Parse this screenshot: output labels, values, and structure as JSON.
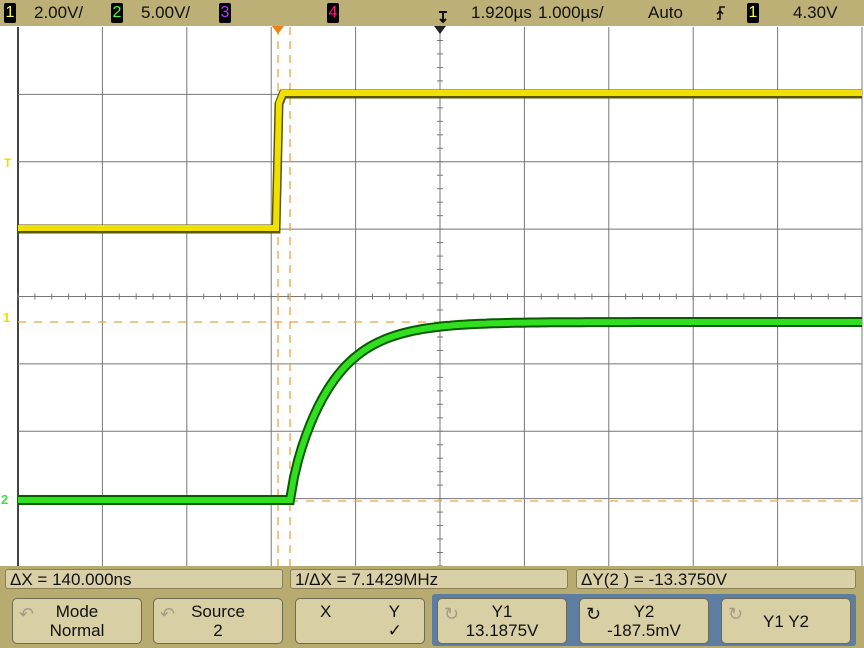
{
  "status_bar": {
    "channels": [
      {
        "number": "1",
        "scale": "2.00V/",
        "color": "#ffff40"
      },
      {
        "number": "2",
        "scale": "5.00V/",
        "color": "#40ff40"
      },
      {
        "number": "3",
        "scale": "",
        "color": "#b040ff"
      },
      {
        "number": "4",
        "scale": "",
        "color": "#ff2080"
      }
    ],
    "time_delay": "1.920µs",
    "time_scale": "1.000µs/",
    "trigger_mode": "Auto",
    "trigger_slope_icon": "rising-edge-icon",
    "trigger_source": "1",
    "trigger_level": "4.30V"
  },
  "plot": {
    "left_markers": [
      {
        "label": "T",
        "name": "trigger-level-marker",
        "color": "#e8e000"
      },
      {
        "label": "1",
        "name": "channel-1-ground-marker",
        "color": "#e8e000"
      },
      {
        "label": "2",
        "name": "channel-2-ground-marker",
        "color": "#40e040"
      }
    ],
    "divisions": {
      "horizontal": 10,
      "vertical": 8
    },
    "colors": {
      "ch1": "#f0e000",
      "ch2": "#30e020",
      "cursor": "#f0a040",
      "grid": "#777777",
      "trigger_marker": "#f08010"
    }
  },
  "measurements": {
    "delta_x": "ΔX = 140.000ns",
    "inv_delta_x": "1/ΔX = 7.1429MHz",
    "delta_y": "ΔY(2 ) = -13.3750V"
  },
  "softkeys": [
    {
      "line1": "Mode",
      "line2": "Normal",
      "icon": "rotate-knob-icon",
      "active": false
    },
    {
      "line1": "Source",
      "line2": "2",
      "icon": "rotate-knob-icon",
      "active": false
    },
    {
      "line1_left": "X",
      "line1_right": "Y",
      "line2": "✓"
    },
    {
      "line1": "Y1",
      "line2": "13.1875V",
      "icon": "rotate-icon",
      "active": false
    },
    {
      "line1": "Y2",
      "line2": "-187.5mV",
      "icon": "rotate-icon",
      "active": true
    },
    {
      "line1": "Y1 Y2",
      "line2": "",
      "icon": "rotate-icon",
      "active": false
    }
  ]
}
